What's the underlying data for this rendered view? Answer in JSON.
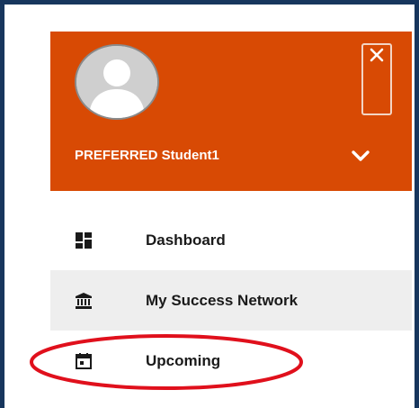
{
  "user": {
    "name": "PREFERRED Student1",
    "avatar_icon": "user-avatar-icon"
  },
  "header": {
    "close_icon": "close-icon",
    "expand_icon": "chevron-down-icon",
    "background_color": "#d84a04"
  },
  "menu": {
    "items": [
      {
        "label": "Dashboard",
        "icon": "dashboard-icon",
        "active": false
      },
      {
        "label": "My Success Network",
        "icon": "institution-icon",
        "active": true
      },
      {
        "label": "Upcoming",
        "icon": "calendar-icon",
        "active": false
      }
    ]
  },
  "annotation": {
    "highlight_color": "#e0101c",
    "highlighted_item": "Upcoming"
  }
}
